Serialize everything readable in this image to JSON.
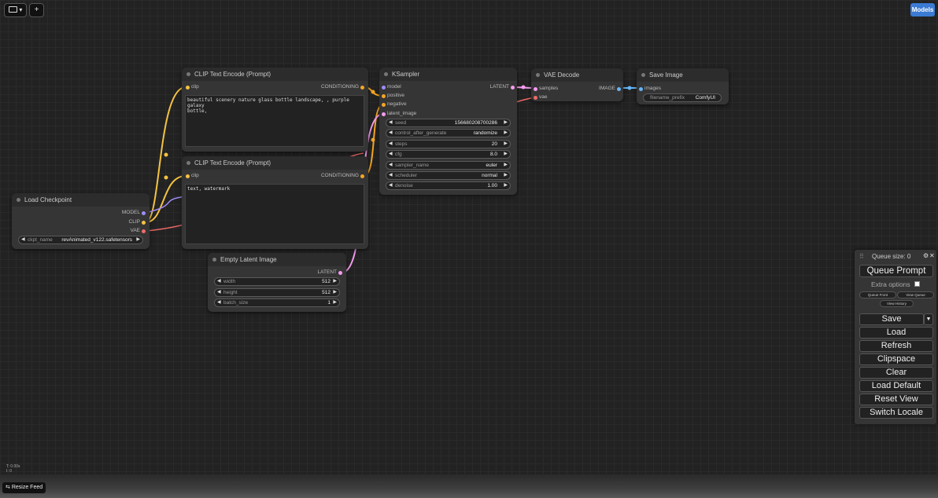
{
  "topbar": {
    "folder_icon": "folder-icon",
    "caret": "▾",
    "add": "+",
    "models": "Models"
  },
  "colors": {
    "clip": "#f5c342",
    "model": "#a08cf8",
    "conditioning": "#f5a623",
    "latent": "#f59cf0",
    "vae": "#f26a6a",
    "image": "#64b5f6"
  },
  "nodes": {
    "clip1": {
      "title": "CLIP Text Encode (Prompt)",
      "in_clip": "clip",
      "out_conditioning": "CONDITIONING",
      "text": "beautiful scenery nature glass bottle landscape, , purple galaxy\nbottle,"
    },
    "clip2": {
      "title": "CLIP Text Encode (Prompt)",
      "in_clip": "clip",
      "out_conditioning": "CONDITIONING",
      "text": "text, watermark"
    },
    "checkpoint": {
      "title": "Load Checkpoint",
      "out_model": "MODEL",
      "out_clip": "CLIP",
      "out_vae": "VAE",
      "ckpt_label": "ckpt_name",
      "ckpt_value": "revAnimated_v122.safetensors"
    },
    "latent": {
      "title": "Empty Latent Image",
      "out_latent": "LATENT",
      "widgets": [
        {
          "label": "width",
          "value": "512"
        },
        {
          "label": "height",
          "value": "512"
        },
        {
          "label": "batch_size",
          "value": "1"
        }
      ]
    },
    "ksampler": {
      "title": "KSampler",
      "in_model": "model",
      "in_positive": "positive",
      "in_negative": "negative",
      "in_latent": "latent_image",
      "out_latent": "LATENT",
      "widgets": [
        {
          "label": "seed",
          "value": "156680208700286"
        },
        {
          "label": "control_after_generate",
          "value": "randomize"
        },
        {
          "label": "steps",
          "value": "20"
        },
        {
          "label": "cfg",
          "value": "8.0"
        },
        {
          "label": "sampler_name",
          "value": "euler"
        },
        {
          "label": "scheduler",
          "value": "normal"
        },
        {
          "label": "denoise",
          "value": "1.00"
        }
      ]
    },
    "vaedecode": {
      "title": "VAE Decode",
      "in_samples": "samples",
      "in_vae": "vae",
      "out_image": "IMAGE"
    },
    "save": {
      "title": "Save Image",
      "in_images": "images",
      "prefix_label": "filename_prefix",
      "prefix_value": "ComfyUI"
    }
  },
  "menu": {
    "queue_size": "Queue size: 0",
    "queue_prompt": "Queue Prompt",
    "extra_options": "Extra options",
    "queue_front": "Queue Front",
    "view_queue": "View Queue",
    "view_history": "View History",
    "save": "Save",
    "load": "Load",
    "refresh": "Refresh",
    "clipspace": "Clipspace",
    "clear": "Clear",
    "load_default": "Load Default",
    "reset_view": "Reset View",
    "switch_locale": "Switch Locale"
  },
  "status": {
    "line1": "T: 0.00s",
    "line2": "I: 0"
  },
  "footer": {
    "resize_feed": "Resize Feed"
  }
}
